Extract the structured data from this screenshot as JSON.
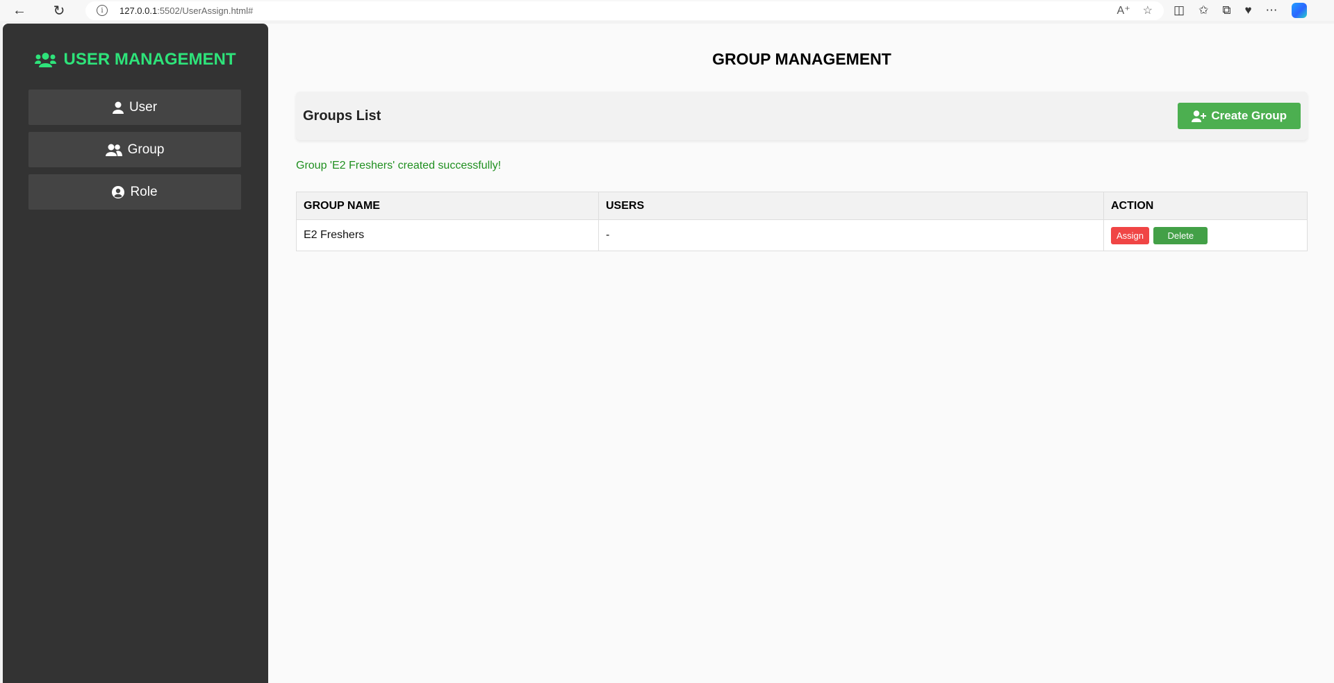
{
  "browser": {
    "url_host": "127.0.0.1",
    "url_path": ":5502/UserAssign.html#",
    "info_glyph": "i"
  },
  "sidebar": {
    "brand": "USER MANAGEMENT",
    "items": [
      {
        "label": "User",
        "icon": "user-icon"
      },
      {
        "label": "Group",
        "icon": "users-icon"
      },
      {
        "label": "Role",
        "icon": "user-circle-icon"
      }
    ]
  },
  "main": {
    "title": "GROUP MANAGEMENT",
    "list_title": "Groups List",
    "create_button": "Create Group",
    "message": "Group 'E2 Freshers' created successfully!",
    "table": {
      "headers": [
        "GROUP NAME",
        "USERS",
        "ACTION"
      ],
      "rows": [
        {
          "group_name": "E2 Freshers",
          "users": "-",
          "assign_label": "Assign",
          "delete_label": "Delete"
        }
      ]
    }
  },
  "colors": {
    "brand": "#2ee37a",
    "sidebar_bg": "#333333",
    "menu_bg": "#444444",
    "create_btn": "#4caf50",
    "assign_btn": "#f04545",
    "delete_btn": "#43a047",
    "success_text": "#1f8f1f"
  }
}
